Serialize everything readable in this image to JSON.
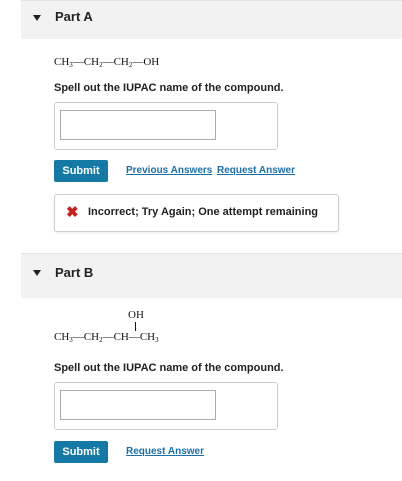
{
  "part_a": {
    "title": "Part A",
    "formula": [
      "CH",
      "3",
      "—CH",
      "2",
      "—CH",
      "2",
      "—OH"
    ],
    "prompt": "Spell out the IUPAC name of the compound.",
    "input_value": "",
    "submit_label": "Submit",
    "previous_answers_label": "Previous Answers",
    "request_answer_label": "Request Answer",
    "feedback": {
      "icon": "x-icon",
      "message": "Incorrect; Try Again; One attempt remaining",
      "color": "#c8201f"
    }
  },
  "part_b": {
    "title": "Part B",
    "formula_top": "OH",
    "formula": [
      "CH",
      "3",
      "—CH",
      "2",
      "—CH—CH",
      "3"
    ],
    "prompt": "Spell out the IUPAC name of the compound.",
    "input_value": "",
    "submit_label": "Submit",
    "request_answer_label": "Request Answer"
  },
  "colors": {
    "submit_bg": "#1579a5",
    "link": "#1a6fa8",
    "header_bg": "#f2f2f2"
  }
}
